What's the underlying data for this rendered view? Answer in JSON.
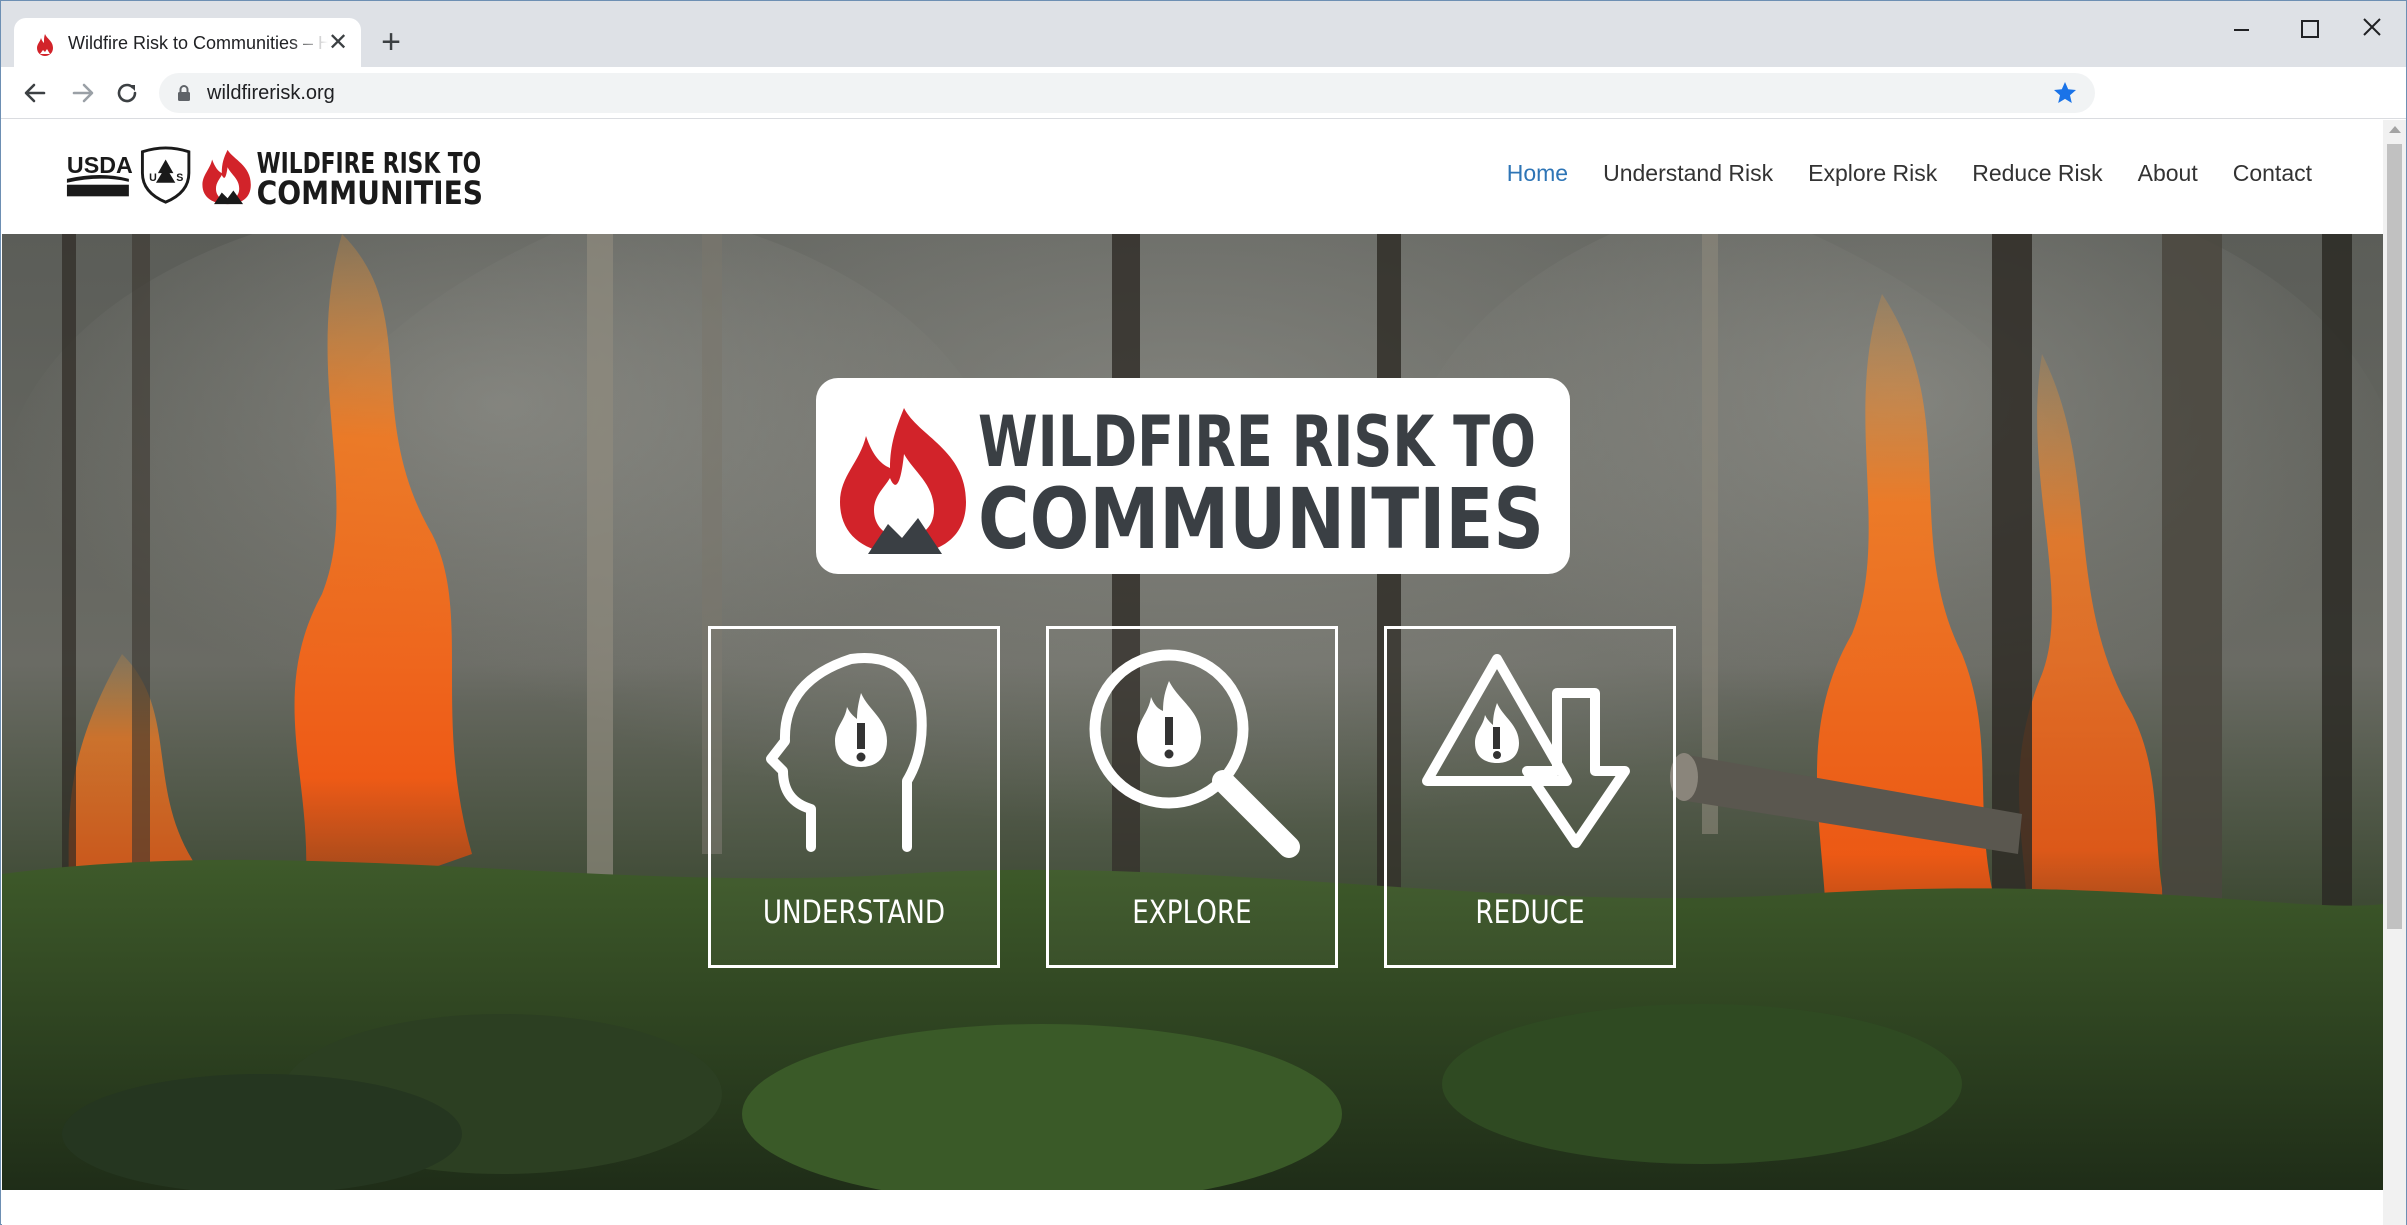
{
  "browser": {
    "tab_title": "Wildfire Risk to Communities – Home",
    "tab_close": "✕",
    "new_tab": "+",
    "url": "wildfirerisk.org"
  },
  "header": {
    "logo_alt": "USDA Forest Service Wildfire Risk to Communities",
    "usda_text": "USDA",
    "logo_line1": "WILDFIRE RISK TO",
    "logo_line2": "COMMUNITIES"
  },
  "nav": {
    "items": [
      {
        "label": "Home",
        "active": true
      },
      {
        "label": "Understand Risk",
        "active": false
      },
      {
        "label": "Explore Risk",
        "active": false
      },
      {
        "label": "Reduce Risk",
        "active": false
      },
      {
        "label": "About",
        "active": false
      },
      {
        "label": "Contact",
        "active": false
      }
    ]
  },
  "hero": {
    "logo_line1": "WILDFIRE RISK TO",
    "logo_line2": "COMMUNITIES",
    "tiles": [
      {
        "label": "UNDERSTAND",
        "icon": "head-fire-icon"
      },
      {
        "label": "EXPLORE",
        "icon": "magnifier-fire-icon"
      },
      {
        "label": "REDUCE",
        "icon": "warning-arrow-down-icon"
      }
    ]
  },
  "colors": {
    "accent_blue": "#2e75b6",
    "brand_red": "#d2232a",
    "brand_dark": "#3a3f44"
  }
}
